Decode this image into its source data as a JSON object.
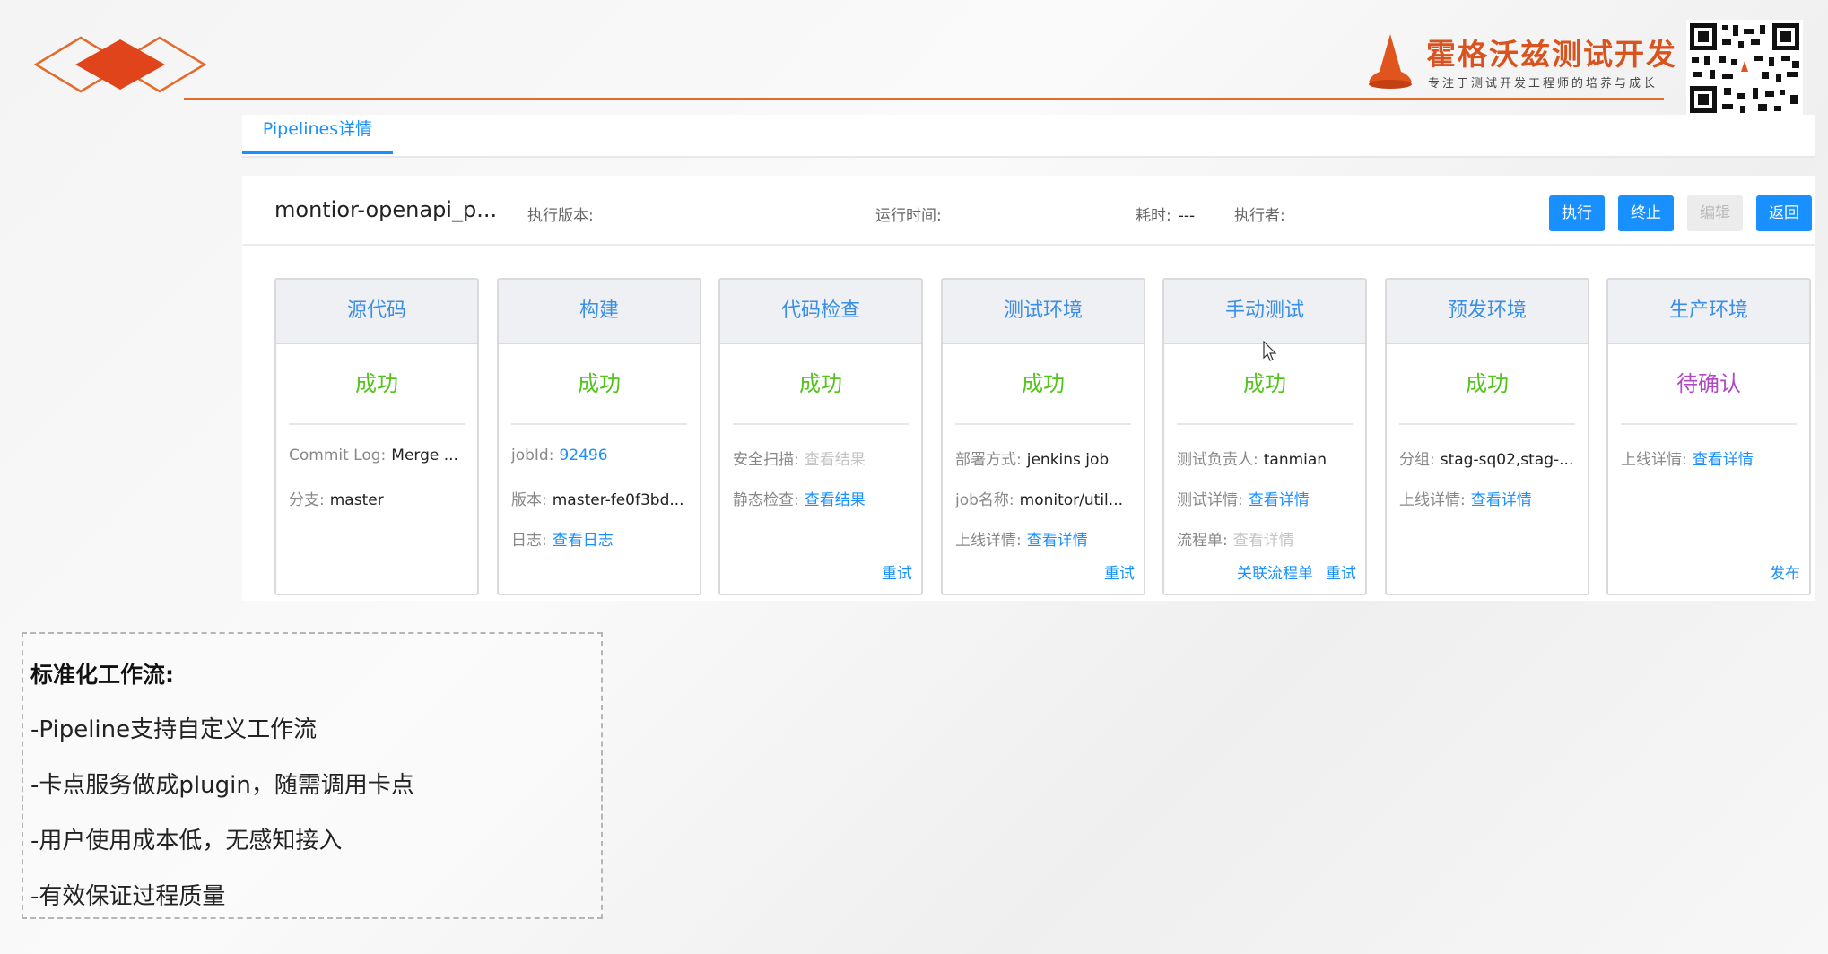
{
  "brand": {
    "name": "霍格沃兹测试开发",
    "slogan": "专注于测试开发工程师的培养与成长",
    "accent": "#e36b2c"
  },
  "tabs": {
    "active_label": "Pipelines详情"
  },
  "pipeline": {
    "name": "montior-openapi_p...",
    "version_label": "执行版本:",
    "version_value": "",
    "runtime_label": "运行时间:",
    "runtime_value": "",
    "duration_label": "耗时:",
    "duration_value": "---",
    "executor_label": "执行者:",
    "executor_value": ""
  },
  "buttons": {
    "run": "执行",
    "stop": "终止",
    "edit": "编辑",
    "back": "返回",
    "primary_color": "#1890ff"
  },
  "stages": [
    {
      "title": "源代码",
      "status": "成功",
      "rows": [
        {
          "key": "Commit Log:",
          "value": "Merge ...",
          "style": "text"
        },
        {
          "key": "分支:",
          "value": "master",
          "style": "text"
        }
      ],
      "actions": []
    },
    {
      "title": "构建",
      "status": "成功",
      "rows": [
        {
          "key": "jobId:",
          "value": "92496",
          "style": "link"
        },
        {
          "key": "版本:",
          "value": "master-fe0f3bd...",
          "style": "text"
        },
        {
          "key": "日志:",
          "value": "查看日志",
          "style": "link"
        }
      ],
      "actions": []
    },
    {
      "title": "代码检查",
      "status": "成功",
      "rows": [
        {
          "key": "安全扫描:",
          "value": "查看结果",
          "style": "disabled"
        },
        {
          "key": "静态检查:",
          "value": "查看结果",
          "style": "link"
        }
      ],
      "actions": [
        "重试"
      ]
    },
    {
      "title": "测试环境",
      "status": "成功",
      "rows": [
        {
          "key": "部署方式:",
          "value": "jenkins job",
          "style": "text"
        },
        {
          "key": "job名称:",
          "value": "monitor/util...",
          "style": "text"
        },
        {
          "key": "上线详情:",
          "value": "查看详情",
          "style": "link"
        }
      ],
      "actions": [
        "重试"
      ]
    },
    {
      "title": "手动测试",
      "status": "成功",
      "rows": [
        {
          "key": "测试负责人:",
          "value": "tanmian",
          "style": "text"
        },
        {
          "key": "测试详情:",
          "value": "查看详情",
          "style": "link"
        },
        {
          "key": "流程单:",
          "value": "查看详情",
          "style": "disabled"
        }
      ],
      "actions": [
        "关联流程单",
        "重试"
      ]
    },
    {
      "title": "预发环境",
      "status": "成功",
      "rows": [
        {
          "key": "分组:",
          "value": "stag-sq02,stag-...",
          "style": "text"
        },
        {
          "key": "上线详情:",
          "value": "查看详情",
          "style": "link"
        }
      ],
      "actions": []
    },
    {
      "title": "生产环境",
      "status": "待确认",
      "rows": [
        {
          "key": "上线详情:",
          "value": "查看详情",
          "style": "link"
        }
      ],
      "actions": [
        "发布"
      ]
    }
  ],
  "status_colors": {
    "success": "#52c41a",
    "pending": "#b048c4"
  },
  "note": {
    "title": "标准化工作流:",
    "items": [
      "-Pipeline支持自定义工作流",
      "-卡点服务做成plugin，随需调用卡点",
      "-用户使用成本低，无感知接入",
      "-有效保证过程质量"
    ]
  }
}
